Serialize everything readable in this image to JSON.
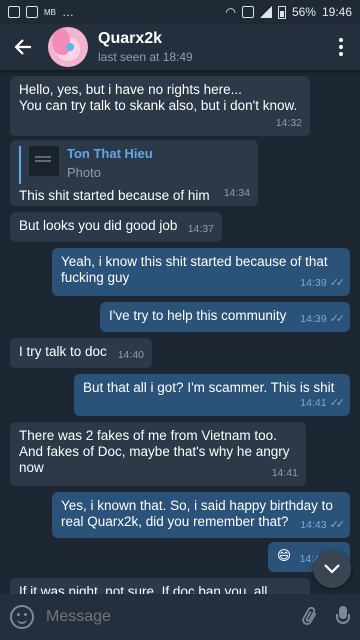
{
  "status_bar": {
    "time": "19:46",
    "battery": "56%",
    "mb_label": "MB"
  },
  "header": {
    "name": "Quarx2k",
    "last_seen": "last seen at 18:49"
  },
  "messages": [
    {
      "dir": "in",
      "lines": [
        "Hello, yes, but i have no rights here...",
        "You can try talk to skank also, but i don't know."
      ],
      "time": "14:32"
    },
    {
      "dir": "in",
      "reply_name": "Ton That Hieu",
      "reply_kind": "Photo",
      "text": "This shit started because of him",
      "time": "14:34"
    },
    {
      "dir": "in",
      "text": "But looks you did good job",
      "time": "14:37"
    },
    {
      "dir": "out",
      "lines": [
        "Yeah, i know this shit started because of that",
        "fucking guy"
      ],
      "time": "14:39"
    },
    {
      "dir": "out",
      "text": "I've try to help this community",
      "time": "14:39"
    },
    {
      "dir": "in",
      "text": "I try  talk to doc",
      "time": "14:40"
    },
    {
      "dir": "out",
      "text": "But that all i got? I'm scammer. This is shit",
      "time": "14:41"
    },
    {
      "dir": "in",
      "lines": [
        "There was 2 fakes of me from Vietnam too.",
        "And fakes of Doc, maybe that's why he angry",
        "now"
      ],
      "time": "14:41"
    },
    {
      "dir": "out",
      "lines": [
        "Yes, i known that. So, i said happy birthday to",
        "real Quarx2k, did you remember that?"
      ],
      "time": "14:43"
    },
    {
      "dir": "out",
      "text": "😄",
      "time": "14:4"
    },
    {
      "dir": "in",
      "text": "If it was night, not sure. If doc ban you, all"
    }
  ],
  "input": {
    "placeholder": "Message"
  },
  "icons": {
    "back": "back-arrow-icon",
    "menu": "more-vertical-icon",
    "emoji": "emoji-icon",
    "attach": "paperclip-icon",
    "mic": "microphone-icon",
    "scroll": "chevron-down-icon"
  },
  "colors": {
    "background": "#1d2733",
    "header": "#242f3d",
    "incoming": "#2b3949",
    "outgoing": "#2b5278",
    "accent": "#62a8e8"
  }
}
